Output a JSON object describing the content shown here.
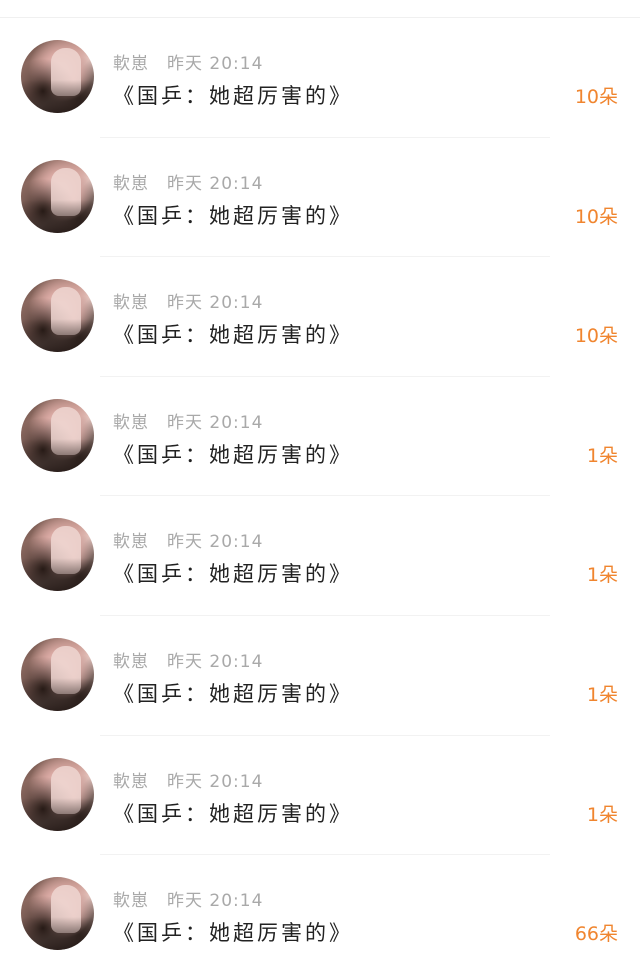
{
  "accent_color": "#f0852f",
  "items": [
    {
      "name": "軟崽",
      "time": "昨天 20:14",
      "title": "《国乒：她超厉害的》",
      "count": "10朵"
    },
    {
      "name": "軟崽",
      "time": "昨天 20:14",
      "title": "《国乒：她超厉害的》",
      "count": "10朵"
    },
    {
      "name": "軟崽",
      "time": "昨天 20:14",
      "title": "《国乒：她超厉害的》",
      "count": "10朵"
    },
    {
      "name": "軟崽",
      "time": "昨天 20:14",
      "title": "《国乒：她超厉害的》",
      "count": "1朵"
    },
    {
      "name": "軟崽",
      "time": "昨天 20:14",
      "title": "《国乒：她超厉害的》",
      "count": "1朵"
    },
    {
      "name": "軟崽",
      "time": "昨天 20:14",
      "title": "《国乒：她超厉害的》",
      "count": "1朵"
    },
    {
      "name": "軟崽",
      "time": "昨天 20:14",
      "title": "《国乒：她超厉害的》",
      "count": "1朵"
    },
    {
      "name": "軟崽",
      "time": "昨天 20:14",
      "title": "《国乒：她超厉害的》",
      "count": "66朵"
    }
  ]
}
